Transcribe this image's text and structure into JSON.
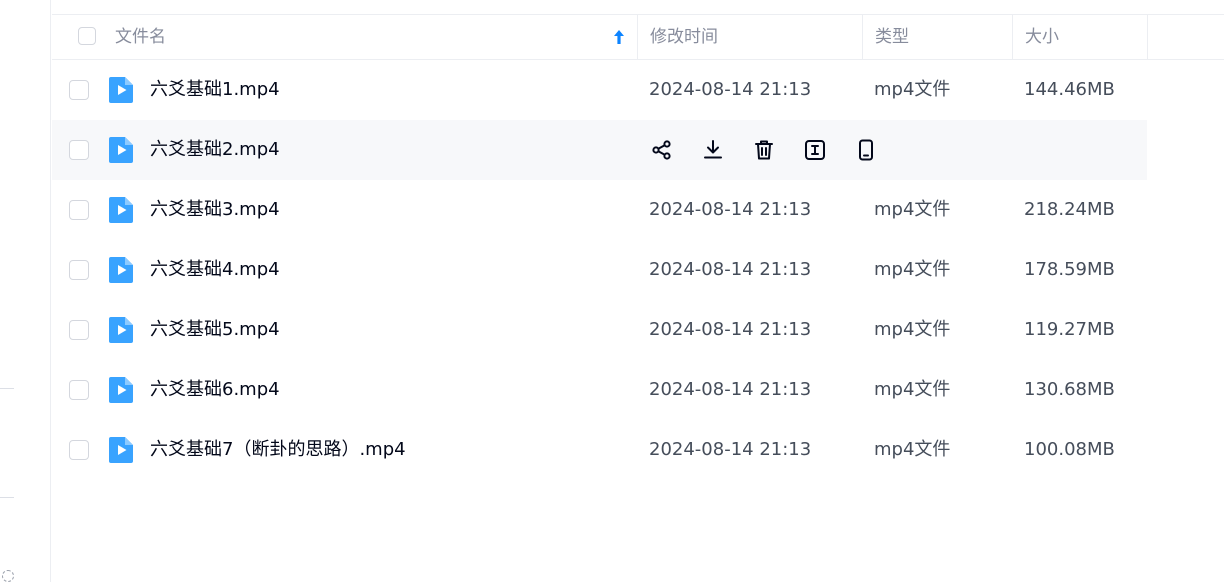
{
  "table": {
    "headers": {
      "name": "文件名",
      "modified": "修改时间",
      "type": "类型",
      "size": "大小"
    },
    "sort": {
      "column": "name",
      "direction": "ascending",
      "icon": "arrow-up-icon"
    },
    "row_actions": [
      "share-icon",
      "download-icon",
      "delete-icon",
      "rename-icon",
      "mobile-icon"
    ],
    "rows": [
      {
        "name": "六爻基础1.mp4",
        "modified": "2024-08-14 21:13",
        "type": "mp4文件",
        "size": "144.46MB"
      },
      {
        "name": "六爻基础2.mp4",
        "modified": "",
        "type": "",
        "size": "",
        "hovered": true
      },
      {
        "name": "六爻基础3.mp4",
        "modified": "2024-08-14 21:13",
        "type": "mp4文件",
        "size": "218.24MB"
      },
      {
        "name": "六爻基础4.mp4",
        "modified": "2024-08-14 21:13",
        "type": "mp4文件",
        "size": "178.59MB"
      },
      {
        "name": "六爻基础5.mp4",
        "modified": "2024-08-14 21:13",
        "type": "mp4文件",
        "size": "119.27MB"
      },
      {
        "name": "六爻基础6.mp4",
        "modified": "2024-08-14 21:13",
        "type": "mp4文件",
        "size": "130.68MB"
      },
      {
        "name": "六爻基础7（断卦的思路）.mp4",
        "modified": "2024-08-14 21:13",
        "type": "mp4文件",
        "size": "100.08MB"
      }
    ]
  },
  "colors": {
    "accent": "#0d84ff",
    "file_icon": "#39a3ff",
    "text_primary": "#03081a",
    "text_secondary": "#454d5a",
    "header_text": "#878c9c",
    "hover_row": "#f7f8fa"
  }
}
